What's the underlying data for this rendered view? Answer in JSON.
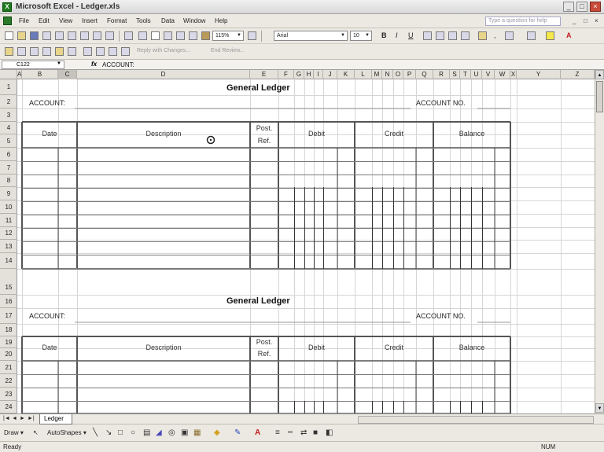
{
  "window": {
    "title": "Microsoft Excel - Ledger.xls",
    "app_icon": "excel-icon",
    "buttons": [
      "_",
      "□",
      "×"
    ]
  },
  "menu": {
    "items": [
      "File",
      "Edit",
      "View",
      "Insert",
      "Format",
      "Tools",
      "Data",
      "Window",
      "Help"
    ],
    "help_placeholder": "Type a question for help",
    "doc_buttons": [
      "_",
      "□",
      "×"
    ]
  },
  "toolbar": {
    "zoom": "115%",
    "font": "Arial",
    "font_size": "10",
    "format_letters": [
      "B",
      "I",
      "U"
    ],
    "reply_text": "Reply with Changes...",
    "end_review_text": "End Review..."
  },
  "formula_bar": {
    "name_box": "C122",
    "fx": "fx",
    "formula": "ACCOUNT:"
  },
  "columns": [
    "A",
    "B",
    "C",
    "D",
    "E",
    "F",
    "G",
    "H",
    "I",
    "J",
    "K",
    "L",
    "M",
    "N",
    "O",
    "P",
    "Q",
    "R",
    "S",
    "T",
    "U",
    "V",
    "W",
    "X",
    "Y",
    "Z"
  ],
  "selected_column": "C",
  "rows": [
    "1",
    "2",
    "3",
    "4",
    "5",
    "6",
    "7",
    "8",
    "9",
    "10",
    "11",
    "12",
    "13",
    "14",
    "15",
    "16",
    "17",
    "18",
    "19",
    "20",
    "21",
    "22",
    "23",
    "24"
  ],
  "ledgers": [
    {
      "title": "General Ledger",
      "account_label": "ACCOUNT:",
      "account_no_label": "ACCOUNT NO.",
      "headers": {
        "date": "Date",
        "description": "Description",
        "post_ref_1": "Post.",
        "post_ref_2": "Ref.",
        "debit": "Debit",
        "credit": "Credit",
        "balance": "Balance"
      }
    },
    {
      "title": "General Ledger",
      "account_label": "ACCOUNT:",
      "account_no_label": "ACCOUNT NO.",
      "headers": {
        "date": "Date",
        "description": "Description",
        "post_ref_1": "Post.",
        "post_ref_2": "Ref.",
        "debit": "Debit",
        "credit": "Credit",
        "balance": "Balance"
      }
    }
  ],
  "sheet_tabs": {
    "nav": [
      "|◄",
      "◄",
      "►",
      "►|"
    ],
    "active": "Ledger"
  },
  "drawing": {
    "draw_label": "Draw ▾",
    "autoshapes_label": "AutoShapes ▾"
  },
  "status": {
    "left": "Ready",
    "right": "NUM"
  }
}
